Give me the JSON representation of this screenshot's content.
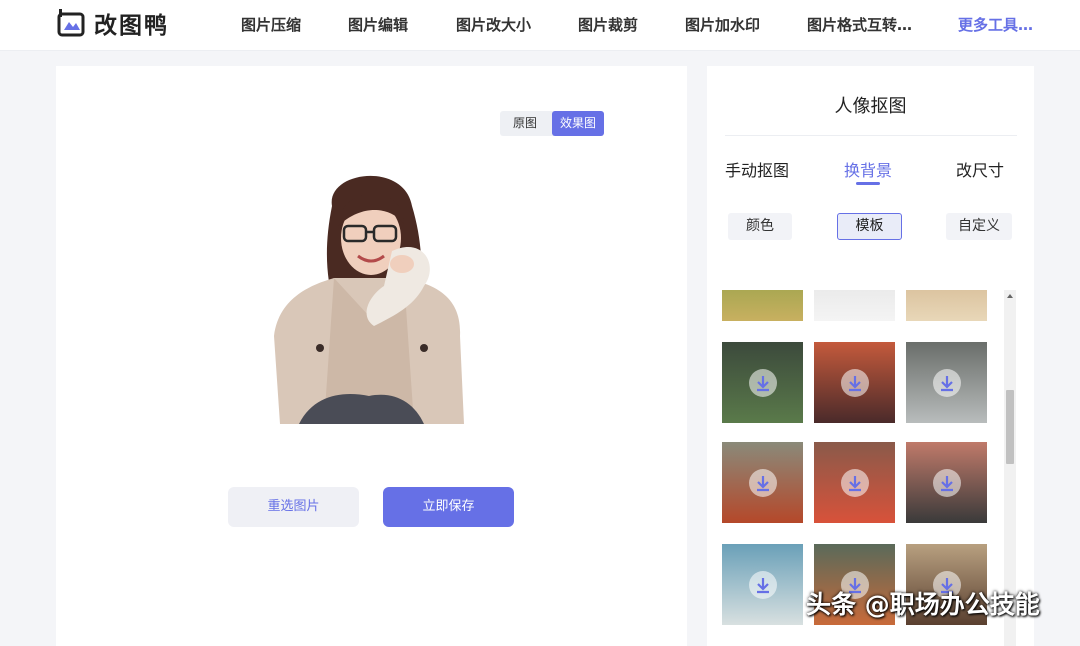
{
  "header": {
    "logo_text": "改图鸭",
    "nav": [
      "图片压缩",
      "图片编辑",
      "图片改大小",
      "图片裁剪",
      "图片加水印",
      "图片格式互转…"
    ],
    "more": "更多工具…"
  },
  "preview": {
    "toggle_original": "原图",
    "toggle_effect": "效果图",
    "reselect_label": "重选图片",
    "save_label": "立即保存"
  },
  "panel": {
    "title": "人像抠图",
    "tabs": [
      "手动抠图",
      "换背景",
      "改尺寸"
    ],
    "active_tab": "换背景",
    "chips": [
      "颜色",
      "模板",
      "自定义"
    ],
    "active_chip": "模板"
  },
  "colors": {
    "accent": "#6670e6",
    "page_bg": "#f4f5f8"
  },
  "watermark": "头条 @职场办公技能"
}
